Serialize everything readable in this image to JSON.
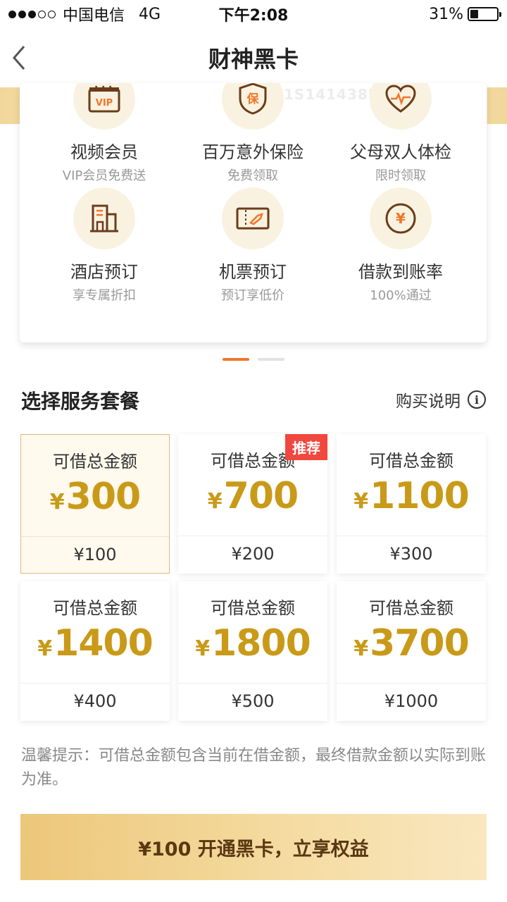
{
  "status_bar": {
    "carrier": "中国电信",
    "network": "4G",
    "time": "下午2:08",
    "battery_text": "31%",
    "battery_level": 0.31
  },
  "nav": {
    "title": "财神黑卡"
  },
  "watermark": "1S141438E27",
  "benefits": [
    {
      "name": "视频会员",
      "sub": "VIP会员免费送",
      "icon": "vip-video-icon",
      "icon_text": "VIP"
    },
    {
      "name": "百万意外保险",
      "sub": "免费领取",
      "icon": "insurance-shield-icon",
      "icon_text": "保"
    },
    {
      "name": "父母双人体检",
      "sub": "限时领取",
      "icon": "heart-checkup-icon"
    },
    {
      "name": "酒店预订",
      "sub": "享专属折扣",
      "icon": "hotel-icon"
    },
    {
      "name": "机票预订",
      "sub": "预订享低价",
      "icon": "flight-ticket-icon"
    },
    {
      "name": "借款到账率",
      "sub": "100%通过",
      "icon": "yen-coin-icon",
      "icon_text": "¥"
    }
  ],
  "section": {
    "title": "选择服务套餐",
    "purchase_info": "购买说明",
    "info_icon_glyph": "i"
  },
  "plans": [
    {
      "label": "可借总金额",
      "currency": "¥",
      "amount": "300",
      "price": "¥100",
      "selected": true
    },
    {
      "label": "可借总金额",
      "currency": "¥",
      "amount": "700",
      "price": "¥200",
      "badge": "推荐"
    },
    {
      "label": "可借总金额",
      "currency": "¥",
      "amount": "1100",
      "price": "¥300"
    },
    {
      "label": "可借总金额",
      "currency": "¥",
      "amount": "1400",
      "price": "¥400"
    },
    {
      "label": "可借总金额",
      "currency": "¥",
      "amount": "1800",
      "price": "¥500"
    },
    {
      "label": "可借总金额",
      "currency": "¥",
      "amount": "3700",
      "price": "¥1000"
    }
  ],
  "tip": "温馨提示：可借总金额包含当前在借金额，最终借款金额以实际到账为准。",
  "cta": {
    "label": "¥100 开通黑卡，立享权益"
  },
  "colors": {
    "accent_gold": "#c99a18",
    "badge_red": "#f0473e",
    "icon_orange": "#f0762a",
    "cta_text": "#5a3812"
  }
}
